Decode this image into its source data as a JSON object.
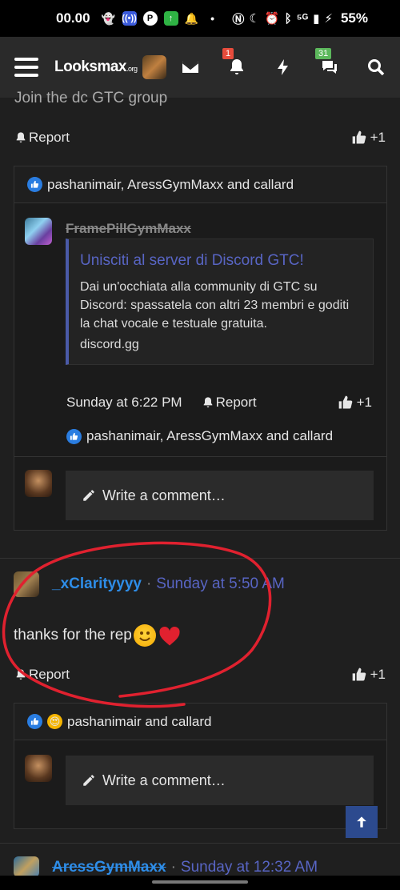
{
  "status_bar": {
    "time": "00.00",
    "network": "⁵ᴳ",
    "battery": "55%"
  },
  "navbar": {
    "logo_main": "Looksmax",
    "logo_suffix": ".org",
    "notifications_badge": "1",
    "conversations_badge": "31",
    "icons": [
      "menu-icon",
      "mail-icon",
      "bell-icon",
      "lightning-icon",
      "chat-icon",
      "search-icon"
    ]
  },
  "post1": {
    "cut_text": "Join the dc GTC group",
    "report_label": "Report",
    "like_label": "+1",
    "reactions_text": "pashanimair, AressGymMaxx and callard"
  },
  "comment1": {
    "author": "FramePillGymMaxx",
    "embed_title": "Unisciti al server di Discord GTC!",
    "embed_desc": "Dai un'occhiata alla community di GTC su Discord: spassatela con altri 23 membri e goditi la chat vocale e testuale gratuita.",
    "embed_link": "discord.gg",
    "time": "Sunday at 6:22 PM",
    "report_label": "Report",
    "like_label": "+1",
    "reactions_text": "pashanimair, AressGymMaxx and callard"
  },
  "write_comment_1": "Write a comment…",
  "post2": {
    "author": "_xClarityyyy",
    "separator": "·",
    "time": "Sunday at 5:50 AM",
    "body": "thanks for the rep",
    "report_label": "Report",
    "like_label": "+1",
    "reactions_text": "pashanimair and callard"
  },
  "write_comment_2": "Write a comment…",
  "post3": {
    "author": "AressGymMaxx",
    "separator": "·",
    "time": "Sunday at 12:32 AM"
  },
  "colors": {
    "background": "#1f1f1f",
    "navbar": "#2a2a2a",
    "username_blue": "#2e8de8",
    "link_purple": "#5865c4",
    "annotation_red": "#e0212f"
  }
}
